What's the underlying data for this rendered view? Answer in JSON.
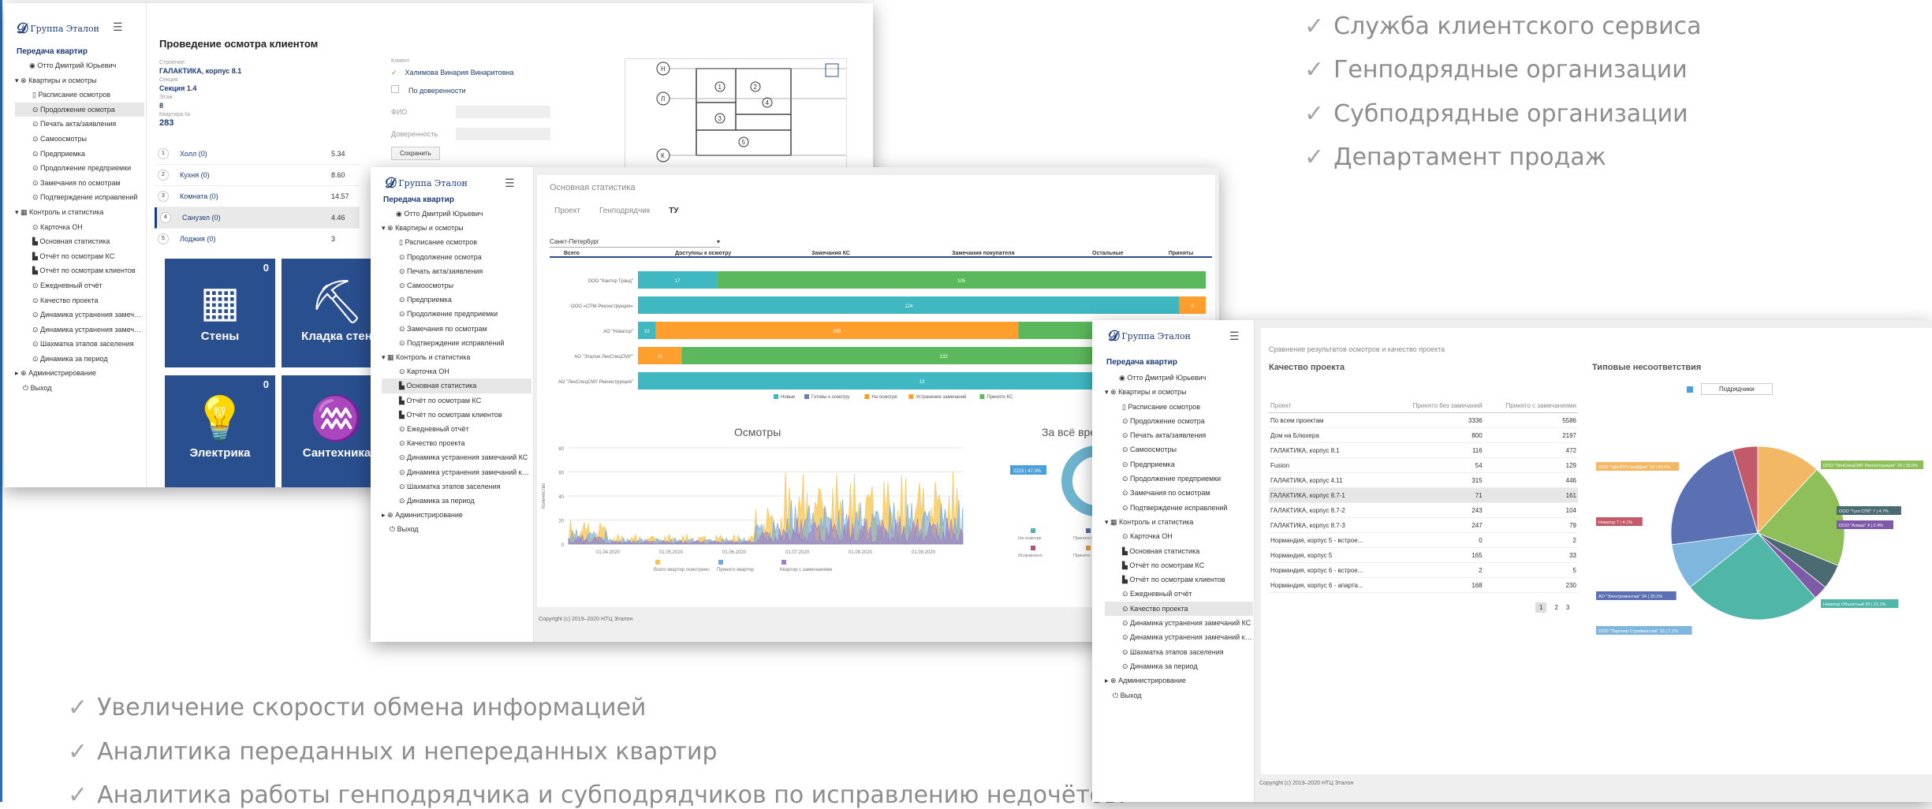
{
  "features_top": [
    "Служба клиентского сервиса",
    "Генподрядные организации",
    "Субподрядные организации",
    "Департамент продаж"
  ],
  "features_bottom": [
    "Увеличение скорости обмена информацией",
    "Аналитика переданных и непереданных квартир",
    "Аналитика работы генподрядчика и субподрядчиков по исправлению недочётов."
  ],
  "checkmark": "✓",
  "colors": {
    "brand": "#1b3a7a",
    "tile": "#2a4f8f",
    "teal": "#3fb8c2",
    "green": "#5cb85c",
    "orange": "#f4a124",
    "blue": "#6fa8dc",
    "purple": "#8e6fbf"
  },
  "app": {
    "logo": "Группа Эталон",
    "nav_title": "Передача квартир",
    "user": "Отто Дмитрий Юрьевич",
    "menu_inspections": "Квартиры и осмотры",
    "menu_control": "Контроль и статистика",
    "menu_admin": "Администрирование",
    "menu_exit": "Выход",
    "copyright": "Copyright (c) 2019–2020 НТЦ Эталон"
  },
  "shot1": {
    "nav": [
      "Расписание осмотров",
      "Продолжение осмотра",
      "Печать акта/заявления",
      "Самоосмотры",
      "Предприемка",
      "Продолжение предприемки",
      "Замечания по осмотрам",
      "Подтверждение исправлений"
    ],
    "nav_control": [
      "Карточка ОН",
      "Основная статистика",
      "Отчёт по осмотрам КС",
      "Отчёт по осмотрам клиентов",
      "Ежедневный отчёт",
      "Качество проекта",
      "Динамика устранения замечаний КС",
      "Динамика устранения замечаний клиентов",
      "Шахматка этапов заселения",
      "Динамика за период"
    ],
    "title": "Проведение осмотра клиентом",
    "obj_label": "Строение:",
    "obj_value": "ГАЛАКТИКА, корпус 8.1",
    "section_label": "Секция",
    "section_value": "Секция 1.4",
    "floor_label": "Этаж",
    "floor_value": "8",
    "flat_label": "Квартира №",
    "flat_value": "283",
    "client_label": "Клиент",
    "client_name": "Халимова Винария Винаритовна",
    "proxy_label": "По доверенности",
    "fio_label": "ФИО",
    "proxy_field_label": "Доверенность",
    "save": "Сохранить",
    "rooms": [
      {
        "n": "1",
        "name": "Холл (0)",
        "area": "5.34"
      },
      {
        "n": "2",
        "name": "Кухня (0)",
        "area": "8.60"
      },
      {
        "n": "3",
        "name": "Комната (0)",
        "area": "14.57"
      },
      {
        "n": "4",
        "name": "Санузел (0)",
        "area": "4.46"
      },
      {
        "n": "5",
        "name": "Лоджия (0)",
        "area": "3"
      }
    ],
    "plan_axes": [
      "Н",
      "Л",
      "К"
    ],
    "plan_rooms": [
      "1",
      "2",
      "3",
      "4",
      "5"
    ],
    "tiles": [
      {
        "label": "Стены",
        "count": "0",
        "icon": "▦"
      },
      {
        "label": "Кладка стен",
        "count": "",
        "icon": "⛏"
      },
      {
        "label": "Электрика",
        "count": "0",
        "icon": "💡"
      },
      {
        "label": "Сантехника",
        "count": "",
        "icon": "♒"
      }
    ]
  },
  "shot2": {
    "nav": [
      "Расписание осмотров",
      "Продолжение осмотра",
      "Печать акта/заявления",
      "Самоосмотры",
      "Предприемка",
      "Продолжение предприемки",
      "Замечания по осмотрам",
      "Подтверждение исправлений"
    ],
    "nav_control": [
      "Карточка ОН",
      "Основная статистика",
      "Отчёт по осмотрам КС",
      "Отчёт по осмотрам клиентов",
      "Ежедневный отчёт",
      "Качество проекта",
      "Динамика устранения замечаний КС",
      "Динамика устранения замечаний клиентов",
      "Шахматка этапов заселения",
      "Динамика за период"
    ],
    "title": "Основная статистика",
    "tabs": [
      "Проект",
      "Генподрядчик",
      "ТУ"
    ],
    "city": "Санкт-Петербург",
    "cols": [
      "Всего",
      "Доступны к осмотру",
      "Замечания КС",
      "Замечания покупателя",
      "Остальные",
      "Приняты"
    ],
    "chart2_title": "Осмотры",
    "chart3_title": "За всё время",
    "donut_label": "2223 | 47.3%",
    "area_legend": [
      "Всего квартир осмотрено",
      "Принято квартир",
      "Квартир с замечаниями"
    ],
    "donut_legend": [
      "На осмотре",
      "Принято с замечаниями",
      "Исправлено",
      "Принято"
    ],
    "y_title": "Количество"
  },
  "shot3": {
    "nav": [
      "Расписание осмотров",
      "Продолжение осмотра",
      "Печать акта/заявления",
      "Самоосмотры",
      "Предприемка",
      "Продолжение предприемки",
      "Замечания по осмотрам",
      "Подтверждение исправлений"
    ],
    "nav_control": [
      "Карточка ОН",
      "Основная статистика",
      "Отчёт по осмотрам КС",
      "Отчёт по осмотрам клиентов",
      "Ежедневный отчёт",
      "Качество проекта",
      "Динамика устранения замечаний КС",
      "Динамика устранения замечаний клиентов",
      "Шахматка этапов заселения",
      "Динамика за период"
    ],
    "title": "Сравнение результатов осмотров и качество проекта",
    "quality_title": "Качество проекта",
    "defects_title": "Типовые несоответствия",
    "filter": "Подрядчики",
    "table_head": [
      "Проект",
      "Принято без замечаний",
      "Принято с замечаниями"
    ],
    "table_rows": [
      [
        "По всем проектам",
        "3336",
        "5586"
      ],
      [
        "Дом на Блюхера",
        "800",
        "2197"
      ],
      [
        "ГАЛАКТИКА, корпус 8.1",
        "116",
        "472"
      ],
      [
        "Fusion",
        "54",
        "129"
      ],
      [
        "ГАЛАКТИКА, корпус 4.11",
        "315",
        "446"
      ],
      [
        "ГАЛАКТИКА, корпус 8.7-1",
        "71",
        "161"
      ],
      [
        "ГАЛАКТИКА, корпус 8.7-2",
        "243",
        "104"
      ],
      [
        "ГАЛАКТИКА, корпус 8.7-3",
        "247",
        "79"
      ],
      [
        "Нормандия, корпус 5 - встрое...",
        "0",
        "2"
      ],
      [
        "Нормандия, корпус 5",
        "165",
        "33"
      ],
      [
        "Нормандия, корпус 6 - встрое...",
        "2",
        "5"
      ],
      [
        "Нормандия, корпус 6 - апарта...",
        "168",
        "230"
      ]
    ],
    "pages": [
      "1",
      "2",
      "3"
    ],
    "pie_labels": [
      "ООО \"ЦЕНТРСтройДом\" 18 | 20.1%",
      "ООО \"ЛенСпецСМУ Реконструкция\" 29 | 15.0%",
      "Новатор 7 | 4.1%",
      "ООО \"Гугл СПб\" 7 | 4.7%",
      "ООО \"Алмаз\" 4 | 2.4%",
      "АО \"Электромонтаж\" 34 | 20.1%",
      "Новатор Объектный 39 | 21.1%",
      "ООО \"Партнер Строймонтаж\" 13 | 7.1%"
    ]
  },
  "chart_data": [
    {
      "type": "bar",
      "categories": [
        "ООО \"Кантор Гранд\"",
        "ООО «СПМ-Реконструкция»",
        "АО \"Новатор\"",
        "АО \"Эталон ЛенСпецСМУ\"",
        "АО \"ЛенСпецСМУ Реконструкция\""
      ],
      "series": [
        {
          "name": "Новые",
          "values": [
            17,
            124,
            10,
            0,
            13
          ]
        },
        {
          "name": "Готовы к осмотру",
          "values": [
            0,
            0,
            0,
            0,
            0
          ]
        },
        {
          "name": "На осмотре",
          "values": [
            0,
            0,
            0,
            0,
            0
          ]
        },
        {
          "name": "Устранение замечаний",
          "values": [
            0,
            6,
            205,
            11,
            0
          ]
        },
        {
          "name": "Принято КС",
          "values": [
            105,
            0,
            106,
            132,
            0
          ]
        }
      ]
    },
    {
      "type": "area",
      "title": "Осмотры",
      "x_ticks": [
        "01.04.2020",
        "01.05.2020",
        "01.06.2020",
        "01.07.2020",
        "01.08.2020",
        "01.09.2020"
      ],
      "y_ticks": [
        0,
        20,
        40,
        60,
        80
      ],
      "series": [
        "Всего квартир осмотрено",
        "Принято квартир",
        "Квартир с замечаниями"
      ]
    },
    {
      "type": "pie",
      "title": "Типовые несоответствия",
      "slices": [
        {
          "label": "ООО \"ЦЕНТРСтройДом\"",
          "value": 18,
          "pct": 20.1
        },
        {
          "label": "ООО \"ЛенСпецСМУ Реконструкция\"",
          "value": 29,
          "pct": 15.0
        },
        {
          "label": "ООО \"Гугл СПб\"",
          "value": 7,
          "pct": 4.7
        },
        {
          "label": "ООО \"Алмаз\"",
          "value": 4,
          "pct": 2.4
        },
        {
          "label": "Новатор Объектный",
          "value": 39,
          "pct": 21.1
        },
        {
          "label": "ООО \"Партнер Строймонтаж\"",
          "value": 13,
          "pct": 7.1
        },
        {
          "label": "АО \"Электромонтаж\"",
          "value": 34,
          "pct": 20.1
        },
        {
          "label": "Новатор",
          "value": 7,
          "pct": 4.1
        }
      ]
    }
  ]
}
